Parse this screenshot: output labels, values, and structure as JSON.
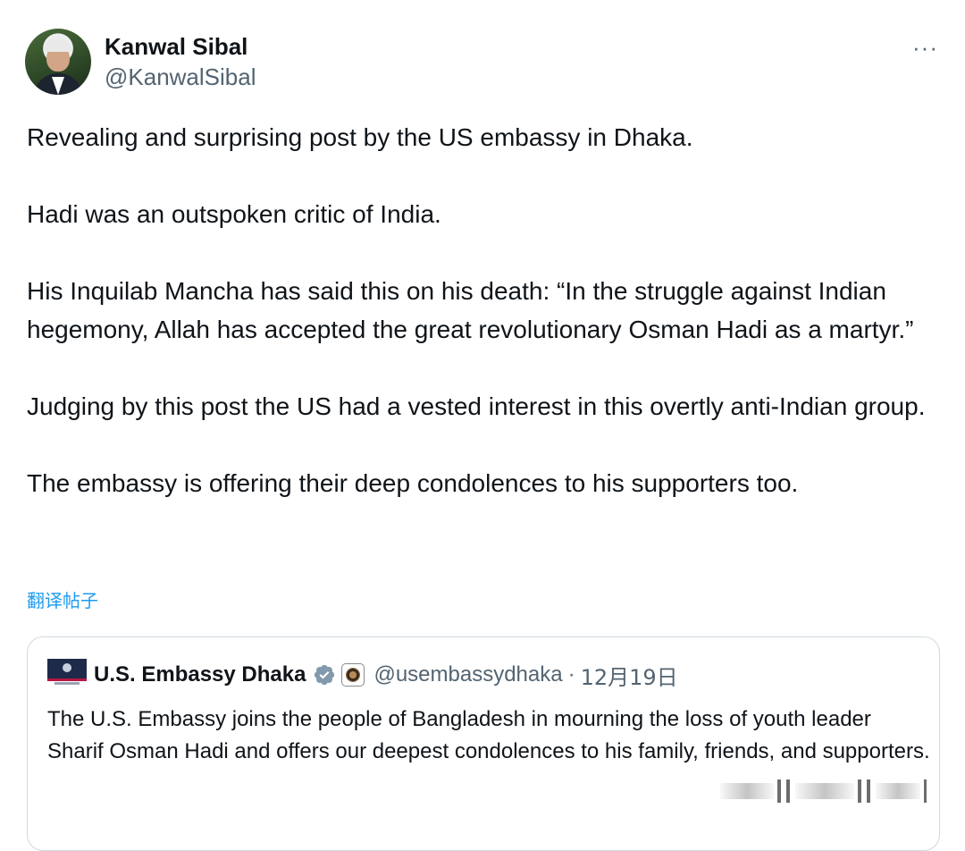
{
  "author": {
    "display_name": "Kanwal Sibal",
    "handle": "@KanwalSibal"
  },
  "more_menu": {
    "label": "···"
  },
  "post": {
    "paragraphs": [
      "Revealing and surprising post by the US embassy in Dhaka.",
      "Hadi was an outspoken critic of India.",
      "His Inquilab Mancha has said this on his death: “In the struggle against Indian hegemony, Allah has accepted the great revolutionary Osman Hadi as a martyr.”",
      "Judging by this post the US had a vested interest in this overtly anti-Indian group.",
      "The embassy is offering their deep condolences to his supporters too."
    ],
    "translate_label": "翻译帖子"
  },
  "quoted": {
    "display_name": "U.S. Embassy Dhaka",
    "handle": "@usembassydhaka",
    "separator": "·",
    "date": "12月19日",
    "text": "The U.S. Embassy joins the people of Bangladesh in mourning the loss of youth leader Sharif Osman Hadi and offers our deepest condolences to his family, friends, and supporters."
  },
  "icons": {
    "verified": "verified-badge-icon",
    "government": "government-affiliation-icon",
    "more": "more-options-icon"
  },
  "colors": {
    "text_primary": "#0f1419",
    "text_secondary": "#536471",
    "link": "#1d9bf0",
    "verified_badge": "#829aab",
    "border": "#cfd9de"
  }
}
